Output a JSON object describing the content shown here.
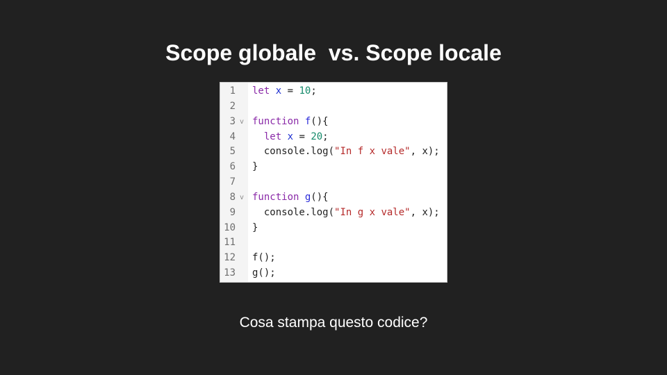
{
  "slide": {
    "title": "Scope globale  vs. Scope locale",
    "question": "Cosa stampa questo codice?"
  },
  "colors": {
    "background": "#212121",
    "keyword": "#8a2aa8",
    "function_name": "#2b2bd9",
    "number": "#148a6a",
    "string": "#b52a2a",
    "variable": "#1e2fd0"
  },
  "code": {
    "language": "javascript",
    "lines": [
      {
        "number": "1",
        "fold": "",
        "tokens": [
          {
            "t": "let ",
            "c": "kw"
          },
          {
            "t": "x",
            "c": "var"
          },
          {
            "t": " = ",
            "c": "plain"
          },
          {
            "t": "10",
            "c": "num"
          },
          {
            "t": ";",
            "c": "plain"
          }
        ]
      },
      {
        "number": "2",
        "fold": "",
        "tokens": []
      },
      {
        "number": "3",
        "fold": "v",
        "tokens": [
          {
            "t": "function ",
            "c": "kw"
          },
          {
            "t": "f",
            "c": "fn"
          },
          {
            "t": "(){",
            "c": "plain"
          }
        ]
      },
      {
        "number": "4",
        "fold": "",
        "tokens": [
          {
            "t": "  ",
            "c": "plain"
          },
          {
            "t": "let ",
            "c": "kw"
          },
          {
            "t": "x",
            "c": "var"
          },
          {
            "t": " = ",
            "c": "plain"
          },
          {
            "t": "20",
            "c": "num"
          },
          {
            "t": ";",
            "c": "plain"
          }
        ]
      },
      {
        "number": "5",
        "fold": "",
        "tokens": [
          {
            "t": "  console.log(",
            "c": "plain"
          },
          {
            "t": "\"In f x vale\"",
            "c": "str"
          },
          {
            "t": ", x);",
            "c": "plain"
          }
        ]
      },
      {
        "number": "6",
        "fold": "",
        "tokens": [
          {
            "t": "}",
            "c": "plain"
          }
        ]
      },
      {
        "number": "7",
        "fold": "",
        "tokens": []
      },
      {
        "number": "8",
        "fold": "v",
        "tokens": [
          {
            "t": "function ",
            "c": "kw"
          },
          {
            "t": "g",
            "c": "fn"
          },
          {
            "t": "(){",
            "c": "plain"
          }
        ]
      },
      {
        "number": "9",
        "fold": "",
        "tokens": [
          {
            "t": "  console.log(",
            "c": "plain"
          },
          {
            "t": "\"In g x vale\"",
            "c": "str"
          },
          {
            "t": ", x);",
            "c": "plain"
          }
        ]
      },
      {
        "number": "10",
        "fold": "",
        "tokens": [
          {
            "t": "}",
            "c": "plain"
          }
        ]
      },
      {
        "number": "11",
        "fold": "",
        "tokens": []
      },
      {
        "number": "12",
        "fold": "",
        "tokens": [
          {
            "t": "f();",
            "c": "plain"
          }
        ]
      },
      {
        "number": "13",
        "fold": "",
        "tokens": [
          {
            "t": "g();",
            "c": "plain"
          }
        ]
      }
    ]
  }
}
